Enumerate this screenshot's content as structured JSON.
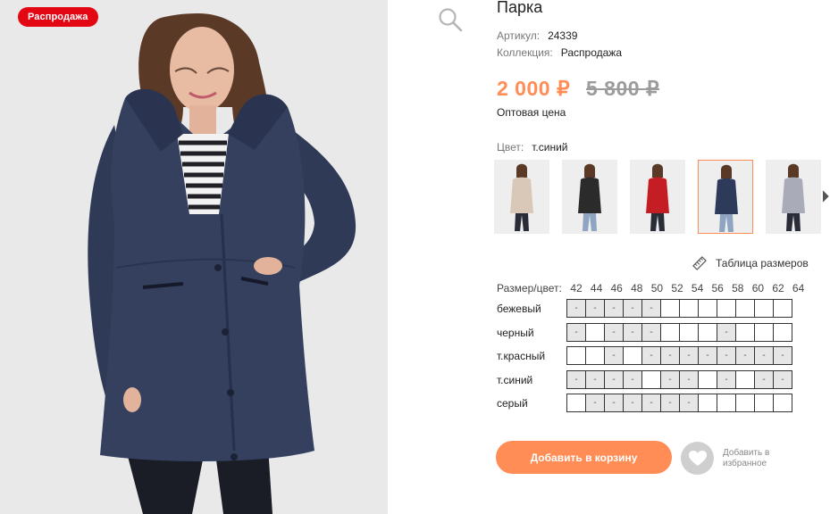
{
  "badge": "Распродажа",
  "product": {
    "title": "Парка",
    "article_label": "Артикул:",
    "article_value": "24339",
    "collection_label": "Коллекция:",
    "collection_value": "Распродажа",
    "price": "2 000 ₽",
    "old_price": "5 800 ₽",
    "price_note": "Оптовая цена",
    "color_label": "Цвет:",
    "color_value": "т.синий"
  },
  "thumbnails": [
    {
      "name": "бежевый",
      "coat": "#d9c8b8"
    },
    {
      "name": "черный",
      "coat": "#2b2b2b"
    },
    {
      "name": "т.красный",
      "coat": "#c41e24"
    },
    {
      "name": "т.синий",
      "coat": "#2e3a5a",
      "active": true
    },
    {
      "name": "серый",
      "coat": "#a9acb8"
    }
  ],
  "size_table_link": "Таблица размеров",
  "size_grid": {
    "header_label": "Размер/цвет:",
    "sizes": [
      "42",
      "44",
      "46",
      "48",
      "50",
      "52",
      "54",
      "56",
      "58",
      "60",
      "62",
      "64"
    ],
    "rows": [
      {
        "label": "бежевый",
        "cells": [
          "-",
          "-",
          "-",
          "-",
          "-",
          "",
          "",
          "",
          "",
          "",
          "",
          ""
        ]
      },
      {
        "label": "черный",
        "cells": [
          "-",
          "",
          "-",
          "-",
          "-",
          "",
          "",
          "",
          "-",
          "",
          "",
          ""
        ]
      },
      {
        "label": "т.красный",
        "cells": [
          "",
          "",
          "-",
          "",
          "-",
          "-",
          "-",
          "-",
          "-",
          "-",
          "-",
          "-"
        ]
      },
      {
        "label": "т.синий",
        "cells": [
          "-",
          "-",
          "-",
          "-",
          "",
          "-",
          "-",
          "",
          "-",
          "",
          "-",
          "-"
        ]
      },
      {
        "label": "серый",
        "cells": [
          "",
          "-",
          "-",
          "-",
          "-",
          "-",
          "-",
          "",
          "",
          "",
          "",
          ""
        ]
      }
    ]
  },
  "actions": {
    "add_to_cart": "Добавить в корзину",
    "add_to_favorites": "Добавить в избранное"
  },
  "colors": {
    "accent": "#ff8d55",
    "badge": "#e30613",
    "old_price": "#9c9c9c",
    "coat_main": "#34405e",
    "unavailable_cell": "#e6e6e6"
  }
}
